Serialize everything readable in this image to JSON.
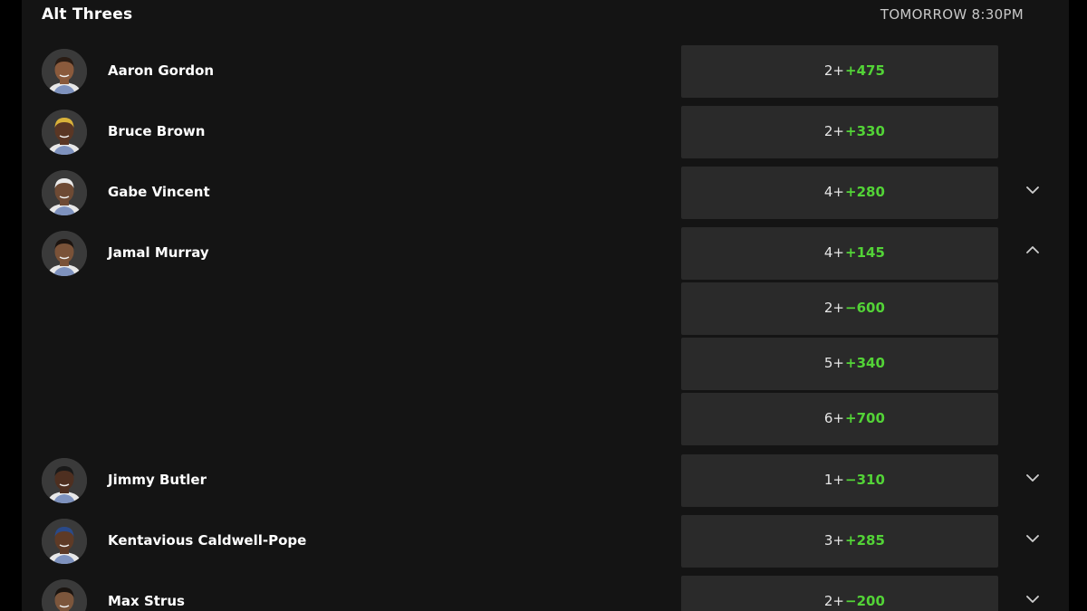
{
  "header": {
    "title": "Alt Threes",
    "time": "TOMORROW 8:30PM"
  },
  "colors": {
    "price_green": "#53d337",
    "button_bg": "#2a2a2a",
    "panel_bg": "#141414"
  },
  "players": [
    {
      "name": "Aaron Gordon",
      "avatar_icon": "player-headshot-icon",
      "toggle": "none",
      "options": [
        {
          "line": "2+",
          "price": "+475"
        }
      ]
    },
    {
      "name": "Bruce Brown",
      "avatar_icon": "player-headshot-icon",
      "toggle": "none",
      "options": [
        {
          "line": "2+",
          "price": "+330"
        }
      ]
    },
    {
      "name": "Gabe Vincent",
      "avatar_icon": "player-headshot-icon",
      "toggle": "chevron-down-icon",
      "options": [
        {
          "line": "4+",
          "price": "+280"
        }
      ]
    },
    {
      "name": "Jamal Murray",
      "avatar_icon": "player-headshot-icon",
      "toggle": "chevron-up-icon",
      "options": [
        {
          "line": "4+",
          "price": "+145"
        },
        {
          "line": "2+",
          "price": "−600"
        },
        {
          "line": "5+",
          "price": "+340"
        },
        {
          "line": "6+",
          "price": "+700"
        }
      ]
    },
    {
      "name": "Jimmy Butler",
      "avatar_icon": "player-headshot-icon",
      "toggle": "chevron-down-icon",
      "options": [
        {
          "line": "1+",
          "price": "−310"
        }
      ]
    },
    {
      "name": "Kentavious Caldwell-Pope",
      "avatar_icon": "player-headshot-icon",
      "toggle": "chevron-down-icon",
      "options": [
        {
          "line": "3+",
          "price": "+285"
        }
      ]
    },
    {
      "name": "Max Strus",
      "avatar_icon": "player-headshot-icon",
      "toggle": "chevron-down-icon",
      "options": [
        {
          "line": "2+",
          "price": "−200"
        }
      ]
    }
  ]
}
